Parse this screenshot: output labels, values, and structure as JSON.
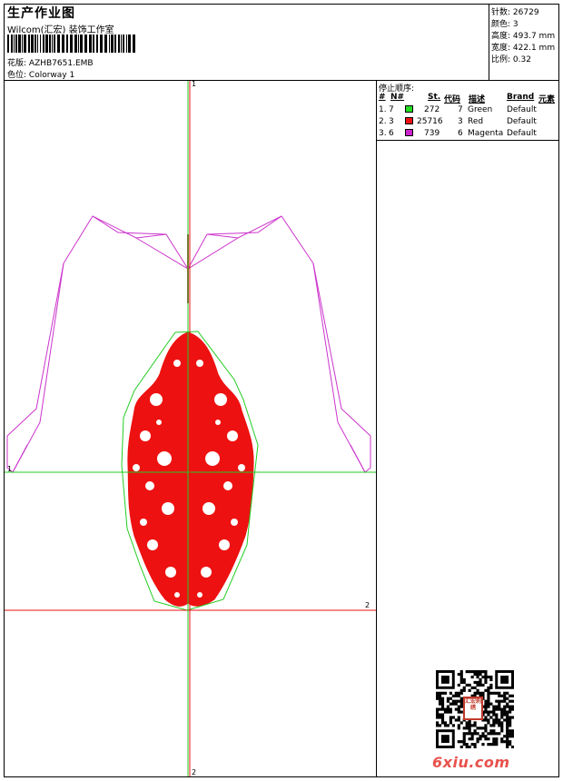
{
  "header": {
    "title": "生产作业图",
    "studio": "Wilcom(汇宏) 装饰工作室",
    "design_label": "花版:",
    "design_value": "AZHB7651.EMB",
    "colorway_label": "色位:",
    "colorway_value": "Colorway 1"
  },
  "stats": [
    {
      "label": "针数:",
      "value": "26729"
    },
    {
      "label": "颜色:",
      "value": "3"
    },
    {
      "label": "高度:",
      "value": "493.7 mm"
    },
    {
      "label": "宽度:",
      "value": "422.1 mm"
    },
    {
      "label": "比例:",
      "value": "0.32"
    }
  ],
  "stop_sequence": {
    "title": "停止顺序:",
    "headers": {
      "n": "#",
      "no": "N#",
      "st": "St.",
      "code": "代码",
      "desc": "描述",
      "brand": "Brand",
      "elem": "元素"
    },
    "rows": [
      {
        "n": "1.",
        "no": "7",
        "color": "#22dd22",
        "st": "272",
        "code": "7",
        "desc": "Green",
        "brand": "Default"
      },
      {
        "n": "2.",
        "no": "3",
        "color": "#ee1111",
        "st": "25716",
        "code": "3",
        "desc": "Red",
        "brand": "Default"
      },
      {
        "n": "3.",
        "no": "6",
        "color": "#cc22cc",
        "st": "739",
        "code": "6",
        "desc": "Magenta",
        "brand": "Default"
      }
    ]
  },
  "axes": {
    "v_top": "1",
    "v_bottom": "2",
    "h_left": "1",
    "h_right": "2",
    "green": "#22cc22",
    "red": "#ee1111",
    "magenta": "#cc33cc"
  },
  "watermark": "6xiu.com",
  "seal_text": "汇宏刺绣"
}
